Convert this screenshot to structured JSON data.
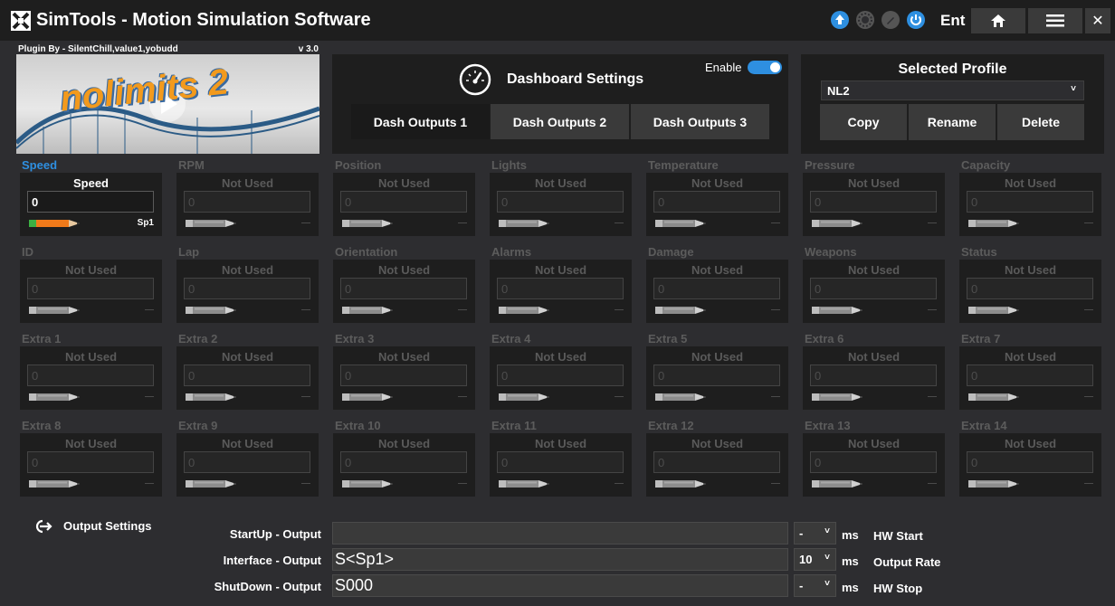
{
  "app": {
    "title": "SimTools - Motion Simulation Software",
    "user": "Ent"
  },
  "titlebar": {
    "home_icon": "home-icon",
    "menu_icon": "hamburger-icon",
    "close_label": "✕"
  },
  "plugin": {
    "author": "Plugin By - SilentChill,value1,yobudd",
    "version": "v 3.0",
    "image_text": "nolimits 2"
  },
  "dashboard": {
    "title": "Dashboard Settings",
    "enable_label": "Enable",
    "enabled": true,
    "tabs": [
      {
        "label": "Dash Outputs 1",
        "active": true
      },
      {
        "label": "Dash Outputs 2",
        "active": false
      },
      {
        "label": "Dash Outputs 3",
        "active": false
      }
    ]
  },
  "profile": {
    "title": "Selected Profile",
    "selected": "NL2",
    "buttons": [
      "Copy",
      "Rename",
      "Delete"
    ]
  },
  "outputs": [
    {
      "label": "Speed",
      "name": "Speed",
      "value": "0",
      "tag": "Sp1",
      "active": true
    },
    {
      "label": "RPM",
      "name": "Not Used",
      "value": "0",
      "tag": "—",
      "active": false
    },
    {
      "label": "Position",
      "name": "Not Used",
      "value": "0",
      "tag": "—",
      "active": false
    },
    {
      "label": "Lights",
      "name": "Not Used",
      "value": "0",
      "tag": "—",
      "active": false
    },
    {
      "label": "Temperature",
      "name": "Not Used",
      "value": "0",
      "tag": "—",
      "active": false
    },
    {
      "label": "Pressure",
      "name": "Not Used",
      "value": "0",
      "tag": "—",
      "active": false
    },
    {
      "label": "Capacity",
      "name": "Not Used",
      "value": "0",
      "tag": "—",
      "active": false
    },
    {
      "label": "ID",
      "name": "Not Used",
      "value": "0",
      "tag": "—",
      "active": false
    },
    {
      "label": "Lap",
      "name": "Not Used",
      "value": "0",
      "tag": "—",
      "active": false
    },
    {
      "label": "Orientation",
      "name": "Not Used",
      "value": "0",
      "tag": "—",
      "active": false
    },
    {
      "label": "Alarms",
      "name": "Not Used",
      "value": "0",
      "tag": "—",
      "active": false
    },
    {
      "label": "Damage",
      "name": "Not Used",
      "value": "0",
      "tag": "—",
      "active": false
    },
    {
      "label": "Weapons",
      "name": "Not Used",
      "value": "0",
      "tag": "—",
      "active": false
    },
    {
      "label": "Status",
      "name": "Not Used",
      "value": "0",
      "tag": "—",
      "active": false
    },
    {
      "label": "Extra 1",
      "name": "Not Used",
      "value": "0",
      "tag": "—",
      "active": false
    },
    {
      "label": "Extra 2",
      "name": "Not Used",
      "value": "0",
      "tag": "—",
      "active": false
    },
    {
      "label": "Extra 3",
      "name": "Not Used",
      "value": "0",
      "tag": "—",
      "active": false
    },
    {
      "label": "Extra 4",
      "name": "Not Used",
      "value": "0",
      "tag": "—",
      "active": false
    },
    {
      "label": "Extra 5",
      "name": "Not Used",
      "value": "0",
      "tag": "—",
      "active": false
    },
    {
      "label": "Extra 6",
      "name": "Not Used",
      "value": "0",
      "tag": "—",
      "active": false
    },
    {
      "label": "Extra 7",
      "name": "Not Used",
      "value": "0",
      "tag": "—",
      "active": false
    },
    {
      "label": "Extra 8",
      "name": "Not Used",
      "value": "0",
      "tag": "—",
      "active": false
    },
    {
      "label": "Extra 9",
      "name": "Not Used",
      "value": "0",
      "tag": "—",
      "active": false
    },
    {
      "label": "Extra 10",
      "name": "Not Used",
      "value": "0",
      "tag": "—",
      "active": false
    },
    {
      "label": "Extra 11",
      "name": "Not Used",
      "value": "0",
      "tag": "—",
      "active": false
    },
    {
      "label": "Extra 12",
      "name": "Not Used",
      "value": "0",
      "tag": "—",
      "active": false
    },
    {
      "label": "Extra 13",
      "name": "Not Used",
      "value": "0",
      "tag": "—",
      "active": false
    },
    {
      "label": "Extra 14",
      "name": "Not Used",
      "value": "0",
      "tag": "—",
      "active": false
    }
  ],
  "output_settings": {
    "title": "Output Settings",
    "unit": "ms",
    "rows": [
      {
        "label": "StartUp - Output",
        "value": "",
        "select": "-",
        "hw": "HW Start"
      },
      {
        "label": "Interface - Output",
        "value": "S<Sp1>",
        "select": "10",
        "hw": "Output Rate"
      },
      {
        "label": "ShutDown - Output",
        "value": "S000",
        "select": "-",
        "hw": "HW Stop"
      }
    ]
  },
  "colors": {
    "accent": "#2e8fe0",
    "panel": "#1e1e1e",
    "background": "#2d2d30",
    "button": "#3a3a3a"
  }
}
